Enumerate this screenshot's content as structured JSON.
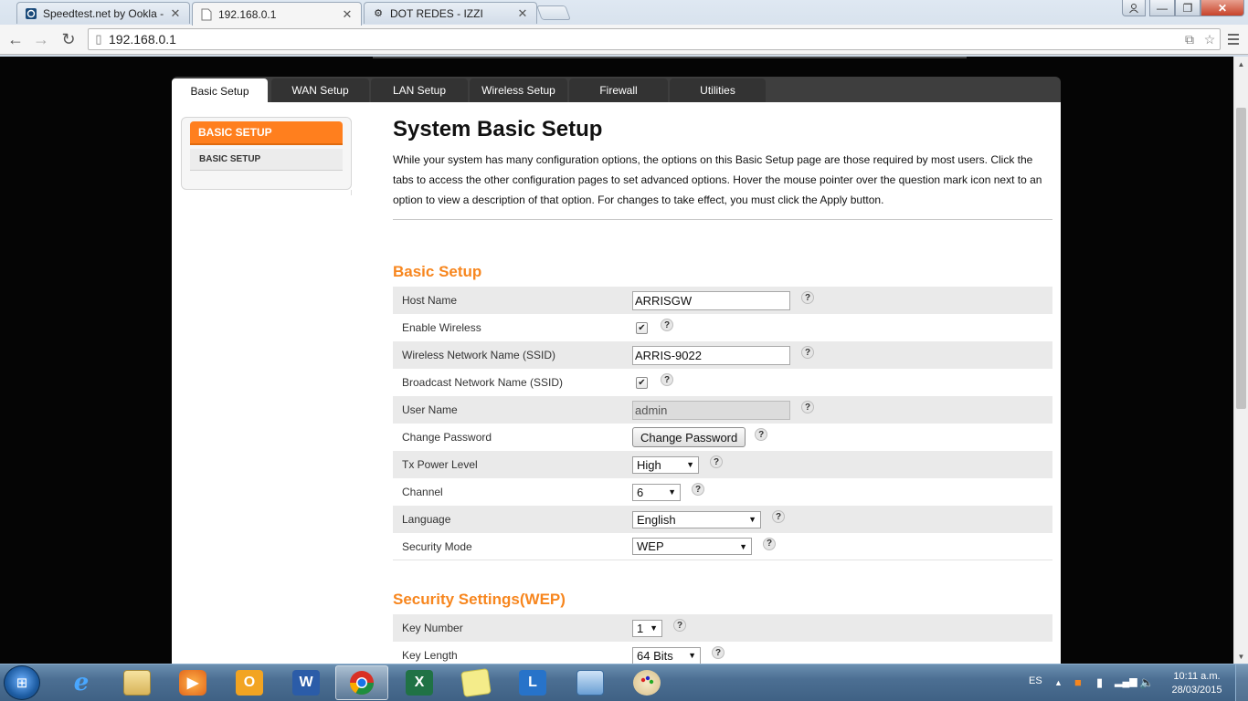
{
  "browser": {
    "tabs": [
      {
        "title": "Speedtest.net by Ookla - ",
        "icon": "speedtest-icon"
      },
      {
        "title": "192.168.0.1",
        "icon": "page-icon"
      },
      {
        "title": "DOT REDES - IZZI",
        "icon": "gear-favicon-icon"
      }
    ],
    "url": "192.168.0.1"
  },
  "router": {
    "tabs": [
      "Basic Setup",
      "WAN Setup",
      "LAN Setup",
      "Wireless Setup",
      "Firewall",
      "Utilities"
    ],
    "active_tab": "Basic Setup",
    "left_nav": {
      "header": "BASIC SETUP",
      "item": "BASIC SETUP"
    },
    "title": "System Basic Setup",
    "description": "While your system has many configuration options, the options on this Basic Setup page are those required by most users. Click the tabs to access the other configuration pages to set advanced options. Hover the mouse pointer over the question mark icon next to an option to view a description of that option. For changes to take effect, you must click the Apply button.",
    "basic_setup": {
      "title": "Basic Setup",
      "host_name": {
        "label": "Host Name",
        "value": "ARRISGW"
      },
      "enable_wireless": {
        "label": "Enable Wireless",
        "checked": true
      },
      "ssid": {
        "label": "Wireless Network Name (SSID)",
        "value": "ARRIS-9022"
      },
      "broadcast_ssid": {
        "label": "Broadcast Network Name (SSID)",
        "checked": true
      },
      "user_name": {
        "label": "User Name",
        "value": "admin"
      },
      "change_password": {
        "label": "Change Password",
        "button": "Change Password"
      },
      "tx_power": {
        "label": "Tx Power Level",
        "value": "High"
      },
      "channel": {
        "label": "Channel",
        "value": "6"
      },
      "language": {
        "label": "Language",
        "value": "English"
      },
      "security_mode": {
        "label": "Security Mode",
        "value": "WEP"
      }
    },
    "security_settings": {
      "title": "Security Settings(WEP)",
      "key_number": {
        "label": "Key Number",
        "value": "1"
      },
      "key_length": {
        "label": "Key Length",
        "value": "64 Bits"
      }
    },
    "help_glyph": "?"
  },
  "taskbar": {
    "apps": [
      "internet-explorer-icon",
      "file-explorer-icon",
      "media-player-icon",
      "outlook-icon",
      "word-icon",
      "chrome-icon",
      "excel-icon",
      "sticky-notes-icon",
      "lync-icon",
      "control-panel-icon",
      "paint-icon"
    ],
    "active_app": "chrome-icon",
    "language": "ES",
    "time": "10:11 a.m.",
    "date": "28/03/2015"
  },
  "colors": {
    "accent_orange": "#f7861e",
    "tab_dark": "#333333"
  }
}
